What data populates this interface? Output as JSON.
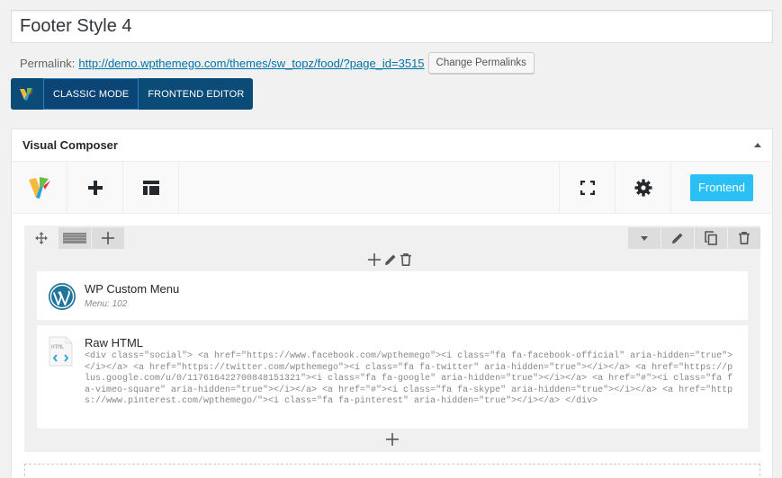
{
  "post": {
    "title": "Footer Style 4"
  },
  "permalink": {
    "label": "Permalink:",
    "url": "http://demo.wpthemego.com/themes/sw_topz/food/?page_id=3515",
    "change_button": "Change Permalinks"
  },
  "modes": {
    "classic": "CLASSIC MODE",
    "frontend": "FRONTEND EDITOR"
  },
  "composer": {
    "title": "Visual Composer",
    "frontend_button": "Frontend",
    "elements": [
      {
        "title": "WP Custom Menu",
        "subtitle": "Menu: 102"
      },
      {
        "title": "Raw HTML",
        "icon_label": "HTML",
        "code": "<div class=\"social\"> <a href=\"https://www.facebook.com/wpthemego\"><i class=\"fa fa-facebook-official\" aria-hidden=\"true\"></i></a> <a href=\"https://twitter.com/wpthemego\"><i class=\"fa fa-twitter\" aria-hidden=\"true\"></i></a> <a href=\"https://plus.google.com/u/0/117616422700848151321\"><i class=\"fa fa-google\" aria-hidden=\"true\"></i></a> <a href=\"#\"><i class=\"fa fa-vimeo-square\" aria-hidden=\"true\"></i></a> <a href=\"#\"><i class=\"fa fa-skype\" aria-hidden=\"true\"></i></a> <a href=\"https://www.pinterest.com/wpthemego/\"><i class=\"fa fa-pinterest\" aria-hidden=\"true\"></i></a> </div>"
      }
    ]
  },
  "colors": {
    "accent": "#0a4b78",
    "frontend": "#2ac0f5",
    "link": "#0073aa",
    "wp_logo": "#21759b"
  }
}
